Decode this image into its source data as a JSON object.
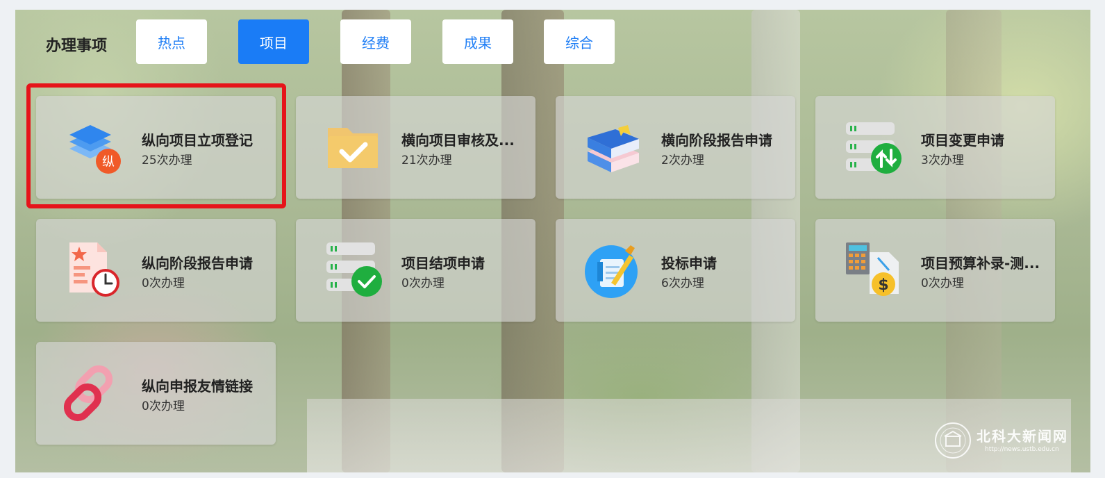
{
  "header": {
    "title": "办理事项"
  },
  "tabs": [
    {
      "label": "热点",
      "active": false
    },
    {
      "label": "项目",
      "active": true
    },
    {
      "label": "经费",
      "active": false
    },
    {
      "label": "成果",
      "active": false
    },
    {
      "label": "综合",
      "active": false
    }
  ],
  "cards": [
    {
      "name": "纵向项目立项登记",
      "count": "25次办理",
      "icon": "stack-layers-icon",
      "badge": "纵",
      "highlighted": true
    },
    {
      "name": "横向项目审核及...",
      "count": "21次办理",
      "icon": "folder-check-icon"
    },
    {
      "name": "横向阶段报告申请",
      "count": "2次办理",
      "icon": "books-icon"
    },
    {
      "name": "项目变更申请",
      "count": "3次办理",
      "icon": "server-exchange-icon"
    },
    {
      "name": "纵向阶段报告申请",
      "count": "0次办理",
      "icon": "document-clock-icon"
    },
    {
      "name": "项目结项申请",
      "count": "0次办理",
      "icon": "server-check-icon"
    },
    {
      "name": "投标申请",
      "count": "6次办理",
      "icon": "pen-document-icon"
    },
    {
      "name": "项目预算补录-测...",
      "count": "0次办理",
      "icon": "calculator-dollar-icon"
    },
    {
      "name": "纵向申报友情链接",
      "count": "0次办理",
      "icon": "chain-link-icon"
    }
  ],
  "watermark": {
    "text": "北科大新闻网",
    "url": "http://news.ustb.edu.cn"
  },
  "colors": {
    "accent": "#1a7cf6",
    "highlight": "#e6141a"
  }
}
